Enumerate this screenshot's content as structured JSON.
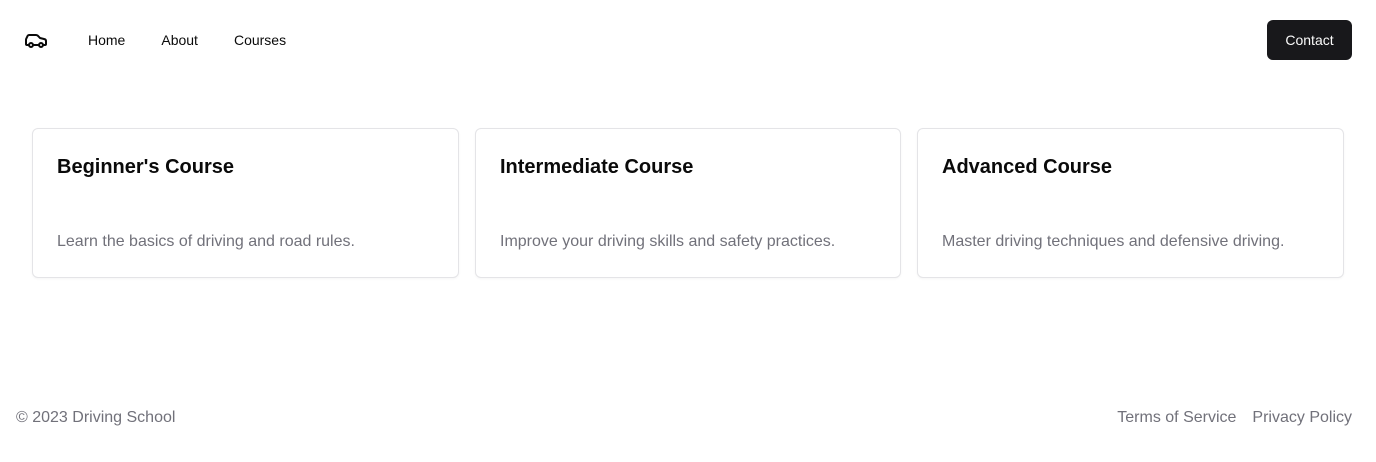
{
  "header": {
    "logo_icon": "car-icon",
    "nav": {
      "home": "Home",
      "about": "About",
      "courses": "Courses"
    },
    "contact_label": "Contact"
  },
  "courses": [
    {
      "title": "Beginner's Course",
      "description": "Learn the basics of driving and road rules."
    },
    {
      "title": "Intermediate Course",
      "description": "Improve your driving skills and safety practices."
    },
    {
      "title": "Advanced Course",
      "description": "Master driving techniques and defensive driving."
    }
  ],
  "footer": {
    "copyright": "© 2023 Driving School",
    "links": {
      "terms": "Terms of Service",
      "privacy": "Privacy Policy"
    }
  },
  "colors": {
    "primary_button": "#18181b",
    "muted_text": "#71717a",
    "card_border": "#e4e4e7"
  }
}
